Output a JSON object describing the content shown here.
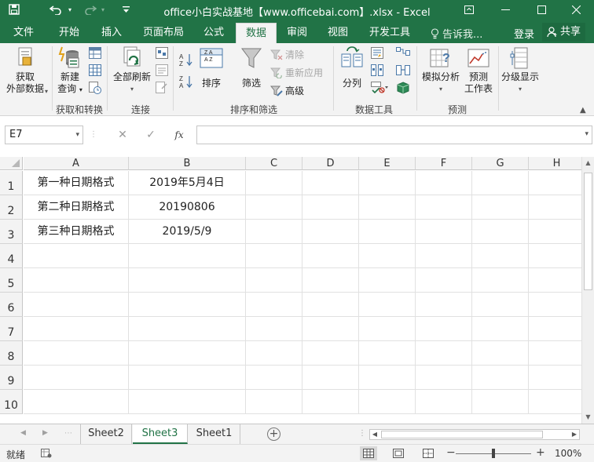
{
  "window": {
    "title": "office小白实战基地【www.officebai.com】.xlsx - Excel",
    "share_label": "共享",
    "login_label": "登录",
    "tell_me": "告诉我..."
  },
  "tabs": [
    {
      "label": "文件",
      "active": false
    },
    {
      "label": "开始",
      "active": false
    },
    {
      "label": "插入",
      "active": false
    },
    {
      "label": "页面布局",
      "active": false
    },
    {
      "label": "公式",
      "active": false
    },
    {
      "label": "数据",
      "active": true
    },
    {
      "label": "审阅",
      "active": false
    },
    {
      "label": "视图",
      "active": false
    },
    {
      "label": "开发工具",
      "active": false
    }
  ],
  "ribbon": {
    "get_external_1": "获取",
    "get_external_2": "外部数据",
    "new_query_1": "新建",
    "new_query_2": "查询",
    "refresh_all": "全部刷新",
    "sort": "排序",
    "filter": "筛选",
    "clear": "清除",
    "reapply": "重新应用",
    "advanced": "高级",
    "text_to_columns": "分列",
    "what_if": "模拟分析",
    "forecast_1": "预测",
    "forecast_2": "工作表",
    "outline": "分级显示",
    "groups": {
      "get_transform": "获取和转换",
      "connections": "连接",
      "sort_filter": "排序和筛选",
      "data_tools": "数据工具",
      "forecast": "预测"
    }
  },
  "formula_bar": {
    "name_box": "E7",
    "cancel": "✕",
    "enter": "✓",
    "fx": "fx",
    "value": ""
  },
  "columns": [
    "A",
    "B",
    "C",
    "D",
    "E",
    "F",
    "G",
    "H"
  ],
  "rows": [
    "1",
    "2",
    "3",
    "4",
    "5",
    "6",
    "7",
    "8",
    "9",
    "10"
  ],
  "cells": {
    "A1": "第一种日期格式",
    "B1": "2019年5月4日",
    "A2": "第二种日期格式",
    "B2": "20190806",
    "A3": "第三种日期格式",
    "B3": "2019/5/9"
  },
  "sheets": [
    {
      "name": "Sheet2",
      "active": false
    },
    {
      "name": "Sheet3",
      "active": true
    },
    {
      "name": "Sheet1",
      "active": false
    }
  ],
  "status": {
    "ready": "就绪",
    "zoom": "100%"
  },
  "colors": {
    "brand": "#217346",
    "ribbon_bg": "#f3f3f3"
  }
}
